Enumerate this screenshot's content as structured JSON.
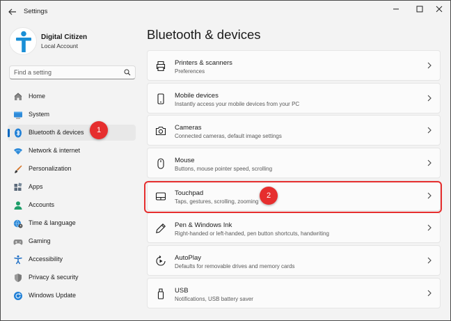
{
  "window": {
    "title": "Settings",
    "back_icon": "back-arrow-icon",
    "controls": [
      "minimize-icon",
      "maximize-icon",
      "close-icon"
    ]
  },
  "user": {
    "name": "Digital Citizen",
    "account_type": "Local Account"
  },
  "search": {
    "placeholder": "Find a setting"
  },
  "sidebar": {
    "items": [
      {
        "label": "Home",
        "icon": "home-icon"
      },
      {
        "label": "System",
        "icon": "system-monitor-icon"
      },
      {
        "label": "Bluetooth & devices",
        "icon": "bluetooth-icon",
        "selected": true
      },
      {
        "label": "Network & internet",
        "icon": "wifi-icon"
      },
      {
        "label": "Personalization",
        "icon": "brush-icon"
      },
      {
        "label": "Apps",
        "icon": "apps-icon"
      },
      {
        "label": "Accounts",
        "icon": "person-icon"
      },
      {
        "label": "Time & language",
        "icon": "globe-clock-icon"
      },
      {
        "label": "Gaming",
        "icon": "gamepad-icon"
      },
      {
        "label": "Accessibility",
        "icon": "accessibility-icon"
      },
      {
        "label": "Privacy & security",
        "icon": "shield-icon"
      },
      {
        "label": "Windows Update",
        "icon": "update-icon"
      }
    ]
  },
  "main": {
    "title": "Bluetooth & devices",
    "cards": [
      {
        "title": "Printers & scanners",
        "description": "Preferences",
        "icon": "printer-icon"
      },
      {
        "title": "Mobile devices",
        "description": "Instantly access your mobile devices from your PC",
        "icon": "phone-icon"
      },
      {
        "title": "Cameras",
        "description": "Connected cameras, default image settings",
        "icon": "camera-icon"
      },
      {
        "title": "Mouse",
        "description": "Buttons, mouse pointer speed, scrolling",
        "icon": "mouse-icon"
      },
      {
        "title": "Touchpad",
        "description": "Taps, gestures, scrolling, zooming",
        "icon": "touchpad-icon"
      },
      {
        "title": "Pen & Windows Ink",
        "description": "Right-handed or left-handed, pen button shortcuts, handwriting",
        "icon": "pen-icon"
      },
      {
        "title": "AutoPlay",
        "description": "Defaults for removable drives and memory cards",
        "icon": "autoplay-icon"
      },
      {
        "title": "USB",
        "description": "Notifications, USB battery saver",
        "icon": "usb-icon"
      }
    ]
  },
  "annotations": {
    "badge_1": "1",
    "badge_2": "2",
    "color": "#e62e2e"
  },
  "colors": {
    "accent": "#0067c0",
    "background": "#f3f3f3",
    "card": "#fbfbfb"
  }
}
